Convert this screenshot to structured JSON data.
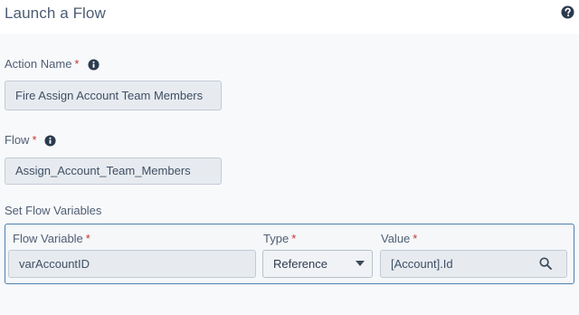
{
  "header": {
    "title": "Launch a Flow",
    "help_icon": "question-circle-icon"
  },
  "required_marker": "*",
  "action_name": {
    "label": "Action Name",
    "value": "Fire Assign Account Team Members",
    "info_icon": "info-icon"
  },
  "flow": {
    "label": "Flow",
    "value": "Assign_Account_Team_Members",
    "info_icon": "info-icon"
  },
  "flow_variables": {
    "section_label": "Set Flow Variables",
    "columns": {
      "variable": "Flow Variable",
      "type": "Type",
      "value": "Value"
    },
    "rows": [
      {
        "variable": "varAccountID",
        "type": "Reference",
        "value": "[Account].Id"
      }
    ]
  },
  "colors": {
    "required": "#c23934",
    "panel_border": "#4d7fb0",
    "icon": "#2b3a4e"
  }
}
